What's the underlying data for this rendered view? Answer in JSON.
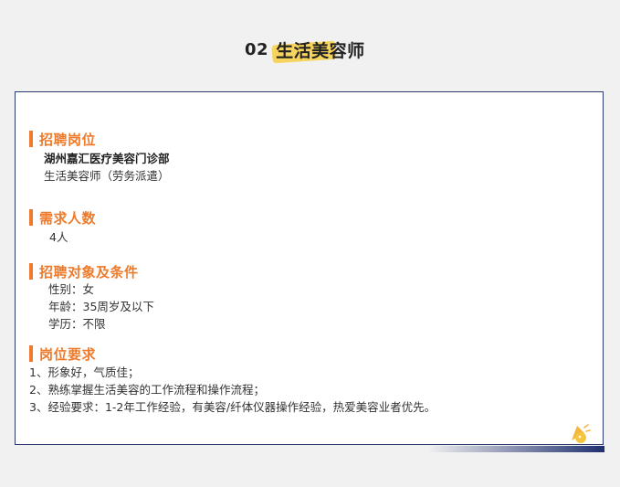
{
  "header": {
    "number": "02",
    "title": "生活美容师"
  },
  "sections": {
    "position": {
      "heading": "招聘岗位",
      "company": "湖州嘉汇医疗美容门诊部",
      "role": "生活美容师（劳务派遣）"
    },
    "headcount": {
      "heading": "需求人数",
      "value": "4人"
    },
    "conditions": {
      "heading": "招聘对象及条件",
      "items": [
        "性别：女",
        "年龄：35周岁及以下",
        "学历：不限"
      ]
    },
    "requirements": {
      "heading": "岗位要求",
      "items": [
        "1、形象好，气质佳；",
        "2、熟练掌握生活美容的工作流程和操作流程；",
        "3、经验要求：1-2年工作经验，有美容/纤体仪器操作经验，热爱美容业者优先。"
      ]
    }
  },
  "colors": {
    "accent": "#ee7a2b",
    "highlight": "#f6d04d",
    "border": "#2a3a6e"
  }
}
